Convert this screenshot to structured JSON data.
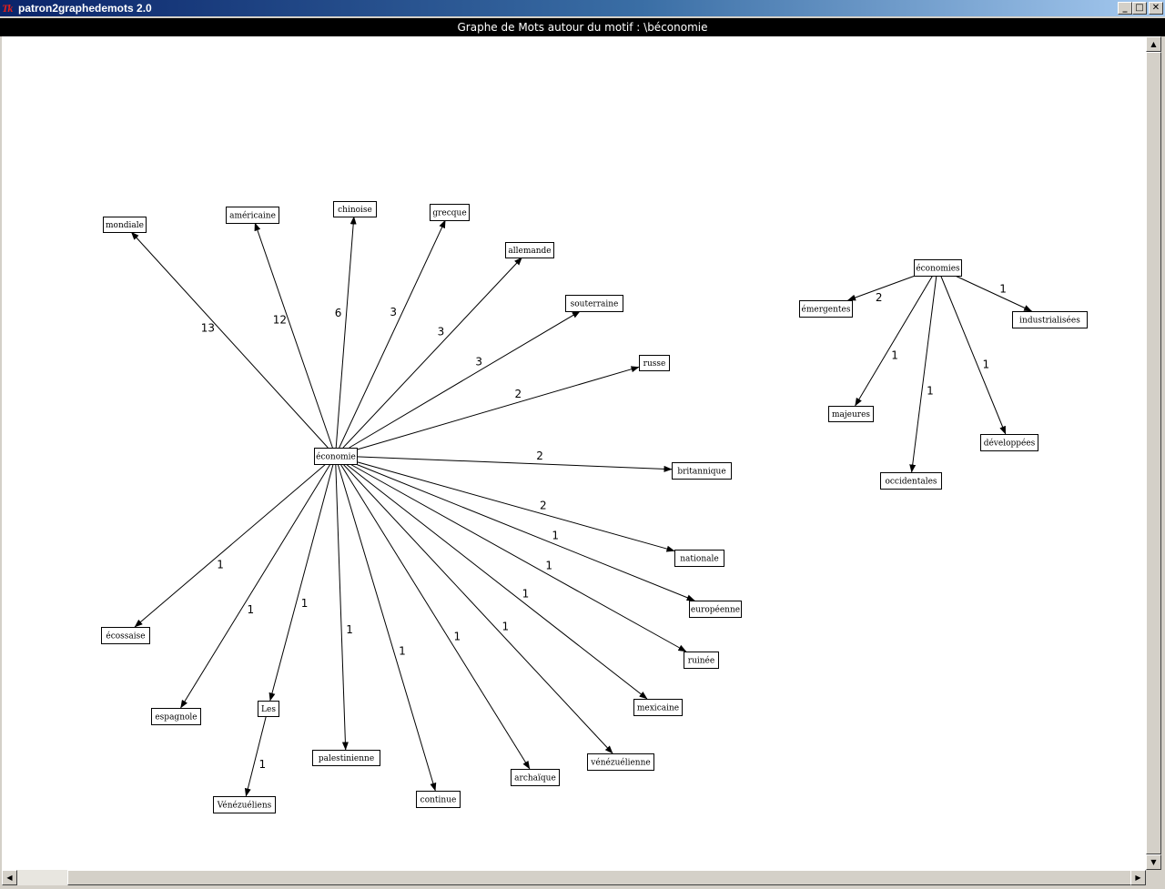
{
  "window": {
    "title": "patron2graphedemots 2.0",
    "icon": "tk-feather-icon",
    "icon_text": "Tk",
    "controls": [
      "_",
      "□",
      "✕"
    ]
  },
  "graph": {
    "header": "Graphe de Mots autour du motif : \\béconomie",
    "nodes": [
      {
        "id": "economie",
        "label": "économie"
      },
      {
        "id": "mondiale",
        "label": "mondiale"
      },
      {
        "id": "americaine",
        "label": "américaine"
      },
      {
        "id": "chinoise",
        "label": "chinoise"
      },
      {
        "id": "grecque",
        "label": "grecque"
      },
      {
        "id": "allemande",
        "label": "allemande"
      },
      {
        "id": "souterraine",
        "label": "souterraine"
      },
      {
        "id": "russe",
        "label": "russe"
      },
      {
        "id": "britannique",
        "label": "britannique"
      },
      {
        "id": "nationale",
        "label": "nationale"
      },
      {
        "id": "europeenne",
        "label": "européenne"
      },
      {
        "id": "ruinee",
        "label": "ruinée"
      },
      {
        "id": "mexicaine",
        "label": "mexicaine"
      },
      {
        "id": "venezuelienne",
        "label": "vénézuélienne"
      },
      {
        "id": "archaique",
        "label": "archaïque"
      },
      {
        "id": "continue",
        "label": "continue"
      },
      {
        "id": "palestinienne",
        "label": "palestinienne"
      },
      {
        "id": "les",
        "label": "Les"
      },
      {
        "id": "espagnole",
        "label": "espagnole"
      },
      {
        "id": "ecossaise",
        "label": "écossaise"
      },
      {
        "id": "venezueliens",
        "label": "Vénézuéliens"
      },
      {
        "id": "economies",
        "label": "économies"
      },
      {
        "id": "emergentes",
        "label": "émergentes"
      },
      {
        "id": "industrialisees",
        "label": "industrialisées"
      },
      {
        "id": "majeures",
        "label": "majeures"
      },
      {
        "id": "occidentales",
        "label": "occidentales"
      },
      {
        "id": "developpees",
        "label": "développées"
      }
    ],
    "edges": [
      {
        "from": "economie",
        "to": "mondiale",
        "weight": "13"
      },
      {
        "from": "economie",
        "to": "americaine",
        "weight": "12"
      },
      {
        "from": "economie",
        "to": "chinoise",
        "weight": "6"
      },
      {
        "from": "economie",
        "to": "grecque",
        "weight": "3"
      },
      {
        "from": "economie",
        "to": "allemande",
        "weight": "3"
      },
      {
        "from": "economie",
        "to": "souterraine",
        "weight": "3"
      },
      {
        "from": "economie",
        "to": "russe",
        "weight": "2"
      },
      {
        "from": "economie",
        "to": "britannique",
        "weight": "2"
      },
      {
        "from": "economie",
        "to": "nationale",
        "weight": "2"
      },
      {
        "from": "economie",
        "to": "europeenne",
        "weight": "1"
      },
      {
        "from": "economie",
        "to": "ruinee",
        "weight": "1"
      },
      {
        "from": "economie",
        "to": "mexicaine",
        "weight": "1"
      },
      {
        "from": "economie",
        "to": "venezuelienne",
        "weight": "1"
      },
      {
        "from": "economie",
        "to": "archaique",
        "weight": "1"
      },
      {
        "from": "economie",
        "to": "continue",
        "weight": "1"
      },
      {
        "from": "economie",
        "to": "palestinienne",
        "weight": "1"
      },
      {
        "from": "economie",
        "to": "les",
        "weight": "1"
      },
      {
        "from": "economie",
        "to": "espagnole",
        "weight": "1"
      },
      {
        "from": "economie",
        "to": "ecossaise",
        "weight": "1"
      },
      {
        "from": "les",
        "to": "venezueliens",
        "weight": "1"
      },
      {
        "from": "economies",
        "to": "emergentes",
        "weight": "2"
      },
      {
        "from": "economies",
        "to": "industrialisees",
        "weight": "1"
      },
      {
        "from": "economies",
        "to": "majeures",
        "weight": "1"
      },
      {
        "from": "economies",
        "to": "occidentales",
        "weight": "1"
      },
      {
        "from": "economies",
        "to": "developpees",
        "weight": "1"
      }
    ]
  },
  "scrollbars": {
    "up_arrow": "▲",
    "down_arrow": "▼",
    "left_arrow": "◀",
    "right_arrow": "▶"
  }
}
